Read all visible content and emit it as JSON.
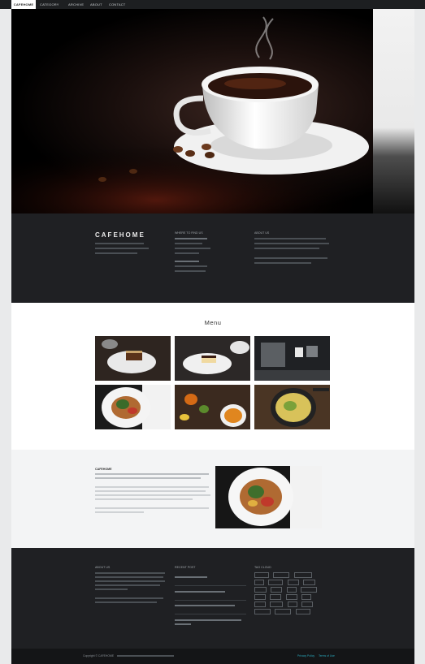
{
  "nav": {
    "items": [
      {
        "label": "CAFEHOME"
      },
      {
        "label": "CATEGORY"
      },
      {
        "label": "ARCHIVE"
      },
      {
        "label": "ABOUT"
      },
      {
        "label": "CONTACT"
      }
    ]
  },
  "about": {
    "brand": "CAFEHOME",
    "where_title": "WHERE TO FIND US",
    "about_title": "ABOUT US"
  },
  "menu": {
    "title": "Menu"
  },
  "promo": {
    "lead": "CAFEHOME"
  },
  "footer": {
    "col1_title": "ABOUT US",
    "col2_title": "RECENT POST",
    "col3_title": "TAG CLOUD",
    "copyright": "Copyright © CAFEHOME",
    "links": [
      "Privacy Policy",
      "Terms of Use"
    ]
  },
  "colors": {
    "nav_bg": "#1d1f21",
    "dark_band": "#1f2023",
    "accent": "#2aa5b8",
    "page_bg": "#e9eaeb"
  }
}
